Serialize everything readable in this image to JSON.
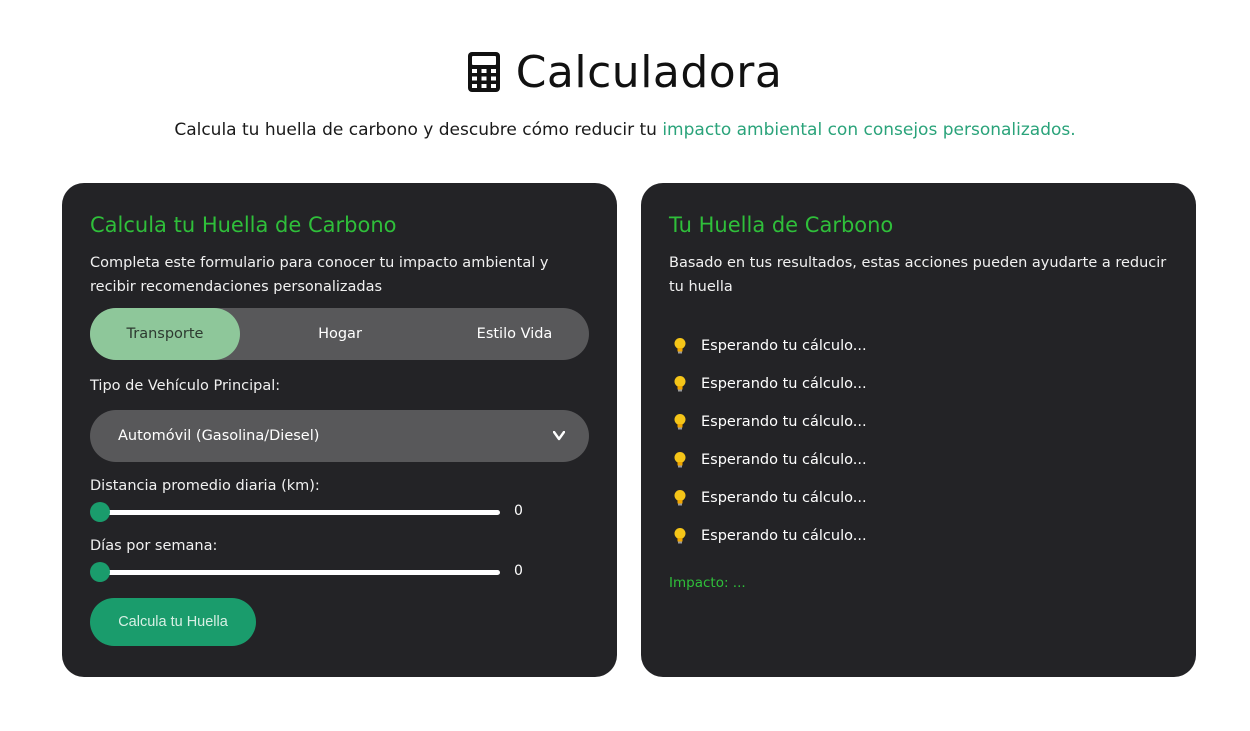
{
  "header": {
    "title": "Calculadora",
    "subtitle_plain": "Calcula tu huella de carbono y descubre cómo reducir tu ",
    "subtitle_accent": "impacto ambiental con consejos personalizados.",
    "icon": "calculator-icon"
  },
  "form_card": {
    "title": "Calcula tu Huella de Carbono",
    "description": "Completa este formulario para conocer tu impacto ambiental y recibir recomendaciones personalizadas",
    "tabs": [
      {
        "label": "Transporte",
        "active": true
      },
      {
        "label": "Hogar",
        "active": false
      },
      {
        "label": "Estilo Vida",
        "active": false
      }
    ],
    "vehicle_label": "Tipo de Vehículo Principal:",
    "vehicle_value": "Automóvil (Gasolina/Diesel)",
    "distance_label": "Distancia promedio diaria (km):",
    "distance_value": "0",
    "days_label": "Días por semana:",
    "days_value": "0",
    "submit_label": "Calcula tu Huella"
  },
  "result_card": {
    "title": "Tu Huella de Carbono",
    "description": "Basado en tus resultados, estas acciones pueden ayudarte a reducir tu huella",
    "tips": [
      "Esperando tu cálculo...",
      "Esperando tu cálculo...",
      "Esperando tu cálculo...",
      "Esperando tu cálculo...",
      "Esperando tu cálculo...",
      "Esperando tu cálculo..."
    ],
    "impact": "Impacto: ..."
  },
  "colors": {
    "accent_green": "#2fbf3a",
    "teal": "#1a9c6c",
    "card_bg": "#232326",
    "tab_active": "#8ec79a"
  }
}
